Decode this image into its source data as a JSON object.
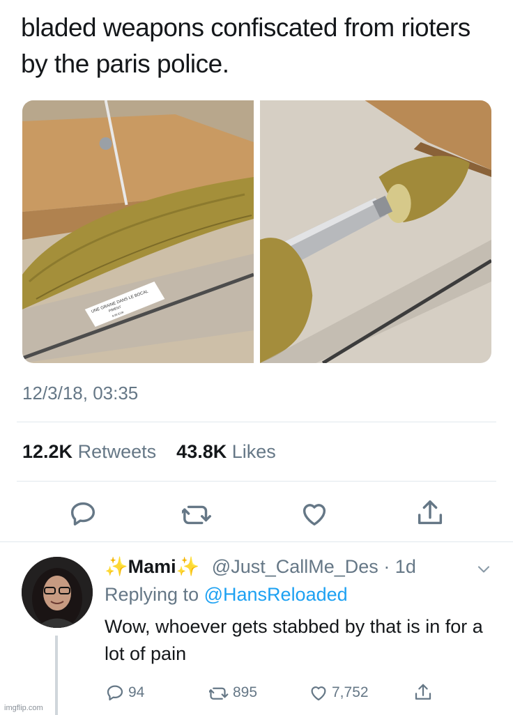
{
  "tweet": {
    "text": "bladed weapons confiscated from rioters by the paris police.",
    "timestamp": "12/3/18, 03:35",
    "retweets_count": "12.2K",
    "retweets_label": "Retweets",
    "likes_count": "43.8K",
    "likes_label": "Likes",
    "photo_left_caption": "UNE GRAINE DANS LE BOCAL",
    "photo_left_caption2": "PIMENT",
    "photo_left_caption3": "8.95 EUR"
  },
  "reply": {
    "sparkle_left": "✨",
    "name": "Mami",
    "sparkle_right": "✨",
    "handle": "@Just_CallMe_Des",
    "time": "· 1d",
    "replying_prefix": "Replying to",
    "replying_to": "@HansReloaded",
    "text": "Wow, whoever gets stabbed by that is in for a lot of pain",
    "replies": "94",
    "retweets": "895",
    "likes": "7,752"
  },
  "watermark": "imgflip.com",
  "colors": {
    "link": "#1da1f2",
    "muted": "#657786",
    "text": "#14171a"
  },
  "icons": [
    "reply-icon",
    "retweet-icon",
    "like-icon",
    "share-icon",
    "chevron-down-icon"
  ]
}
